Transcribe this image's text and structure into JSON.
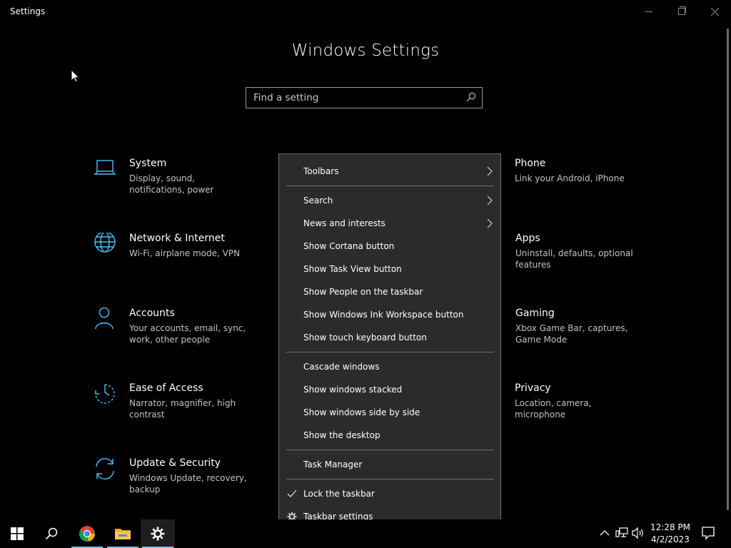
{
  "window": {
    "title": "Settings"
  },
  "page": {
    "title": "Windows Settings"
  },
  "search": {
    "placeholder": "Find a setting"
  },
  "tiles": [
    {
      "name": "System",
      "desc": "Display, sound, notifications, power",
      "icon": "laptop-icon"
    },
    {
      "name": "Network & Internet",
      "desc": "Wi-Fi, airplane mode, VPN",
      "icon": "globe-icon"
    },
    {
      "name": "Accounts",
      "desc": "Your accounts, email, sync, work, other people",
      "icon": "person-icon"
    },
    {
      "name": "Ease of Access",
      "desc": "Narrator, magnifier, high contrast",
      "icon": "ease-of-access-icon"
    },
    {
      "name": "Update & Security",
      "desc": "Windows Update, recovery, backup",
      "icon": "sync-icon"
    },
    {
      "name": "Phone",
      "desc": "Link your Android, iPhone",
      "icon": "phone-icon"
    },
    {
      "name": "Apps",
      "desc": "Uninstall, defaults, optional features",
      "icon": "apps-icon"
    },
    {
      "name": "Gaming",
      "desc": "Xbox Game Bar, captures, Game Mode",
      "icon": "gaming-icon"
    },
    {
      "name": "Privacy",
      "desc": "Location, camera, microphone",
      "icon": "lock-icon"
    }
  ],
  "context_menu": {
    "items": [
      {
        "label": "Toolbars",
        "submenu": true
      },
      {
        "label": "Search",
        "submenu": true
      },
      {
        "label": "News and interests",
        "submenu": true
      },
      {
        "label": "Show Cortana button"
      },
      {
        "label": "Show Task View button"
      },
      {
        "label": "Show People on the taskbar"
      },
      {
        "label": "Show Windows Ink Workspace button"
      },
      {
        "label": "Show touch keyboard button"
      },
      {
        "label": "Cascade windows"
      },
      {
        "label": "Show windows stacked"
      },
      {
        "label": "Show windows side by side"
      },
      {
        "label": "Show the desktop"
      },
      {
        "label": "Task Manager"
      },
      {
        "label": "Lock the taskbar",
        "checked": true
      },
      {
        "label": "Taskbar settings",
        "icon": "gear-icon"
      }
    ]
  },
  "taskbar": {
    "clock": {
      "time": "12:28 PM",
      "date": "4/2/2023"
    },
    "accent": "#7cc1ee"
  },
  "colors": {
    "icon_accent": "#4cc2ff",
    "menu_bg": "#2b2b2b"
  }
}
